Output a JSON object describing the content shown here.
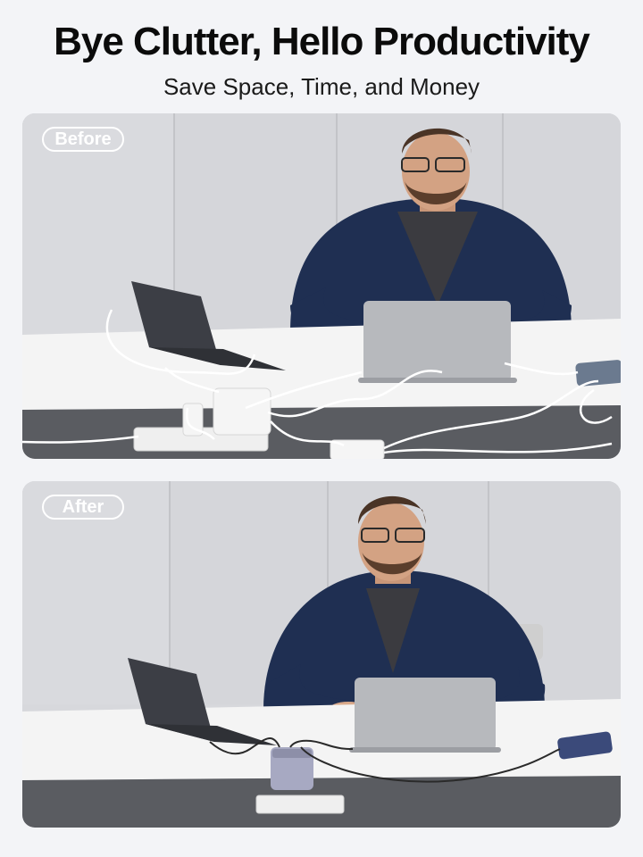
{
  "header": {
    "title": "Bye Clutter, Hello Productivity",
    "subtitle": "Save Space, Time, and Money"
  },
  "panels": [
    {
      "label": "Before"
    },
    {
      "label": "After"
    }
  ],
  "colors": {
    "background": "#f3f4f7",
    "wall": "#d7d8dc",
    "desk_top": "#f4f4f4",
    "desk_front": "#5a5c61",
    "shirt": "#1f2f52",
    "laptop": "#b7b9bd",
    "cable": "#ffffff",
    "charger": "#a7a9c2"
  }
}
